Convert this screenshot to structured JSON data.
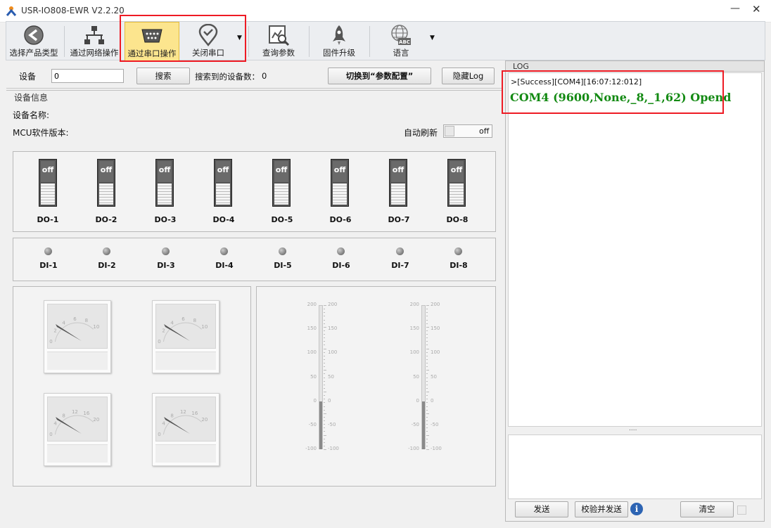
{
  "window": {
    "title": "USR-IO808-EWR V2.2.20"
  },
  "toolbar": {
    "items": [
      {
        "label": "选择产品类型",
        "icon": "back-arrow-icon"
      },
      {
        "label": "通过网络操作",
        "icon": "network-icon"
      },
      {
        "label": "通过串口操作",
        "icon": "serial-port-icon",
        "active": true
      },
      {
        "label": "关闭串口",
        "icon": "location-check-icon"
      },
      {
        "label": "查询参数",
        "icon": "query-chart-icon"
      },
      {
        "label": "固件升级",
        "icon": "rocket-icon"
      },
      {
        "label": "语言",
        "icon": "globe-abc-icon"
      }
    ]
  },
  "device_bar": {
    "device_label": "设备",
    "device_value": "0",
    "search_label": "搜索",
    "found_label": "搜索到的设备数：",
    "found_count": "0",
    "switch_label": "切换到“参数配置”",
    "hide_log_label": "隐藏Log"
  },
  "info": {
    "group_title": "设备信息",
    "name_label": "设备名称:",
    "mcu_label": "MCU软件版本:",
    "auto_refresh_label": "自动刷新",
    "auto_refresh_state": "off"
  },
  "do_outputs": [
    {
      "label": "DO-1",
      "state": "off"
    },
    {
      "label": "DO-2",
      "state": "off"
    },
    {
      "label": "DO-3",
      "state": "off"
    },
    {
      "label": "DO-4",
      "state": "off"
    },
    {
      "label": "DO-5",
      "state": "off"
    },
    {
      "label": "DO-6",
      "state": "off"
    },
    {
      "label": "DO-7",
      "state": "off"
    },
    {
      "label": "DO-8",
      "state": "off"
    }
  ],
  "di_inputs": [
    {
      "label": "DI-1"
    },
    {
      "label": "DI-2"
    },
    {
      "label": "DI-3"
    },
    {
      "label": "DI-4"
    },
    {
      "label": "DI-5"
    },
    {
      "label": "DI-6"
    },
    {
      "label": "DI-7"
    },
    {
      "label": "DI-8"
    }
  ],
  "gauges": [
    {
      "ticks": [
        "0",
        "2",
        "4",
        "6",
        "8",
        "10"
      ],
      "value": 0
    },
    {
      "ticks": [
        "0",
        "2",
        "4",
        "6",
        "8",
        "10"
      ],
      "value": 0
    },
    {
      "ticks": [
        "0",
        "4",
        "8",
        "12",
        "16",
        "20"
      ],
      "value": 0
    },
    {
      "ticks": [
        "0",
        "4",
        "8",
        "12",
        "16",
        "20"
      ],
      "value": 0
    }
  ],
  "sliders": {
    "ticks": [
      "200",
      "150",
      "100",
      "50",
      "0",
      "-50",
      "-100"
    ],
    "values": [
      0,
      0
    ]
  },
  "log": {
    "title": "LOG",
    "line1": ">[Success][COM4][16:07:12:012]",
    "line2": "COM4 (9600,None,_8,_1,62) Opend",
    "line2_color": "#138a13",
    "splitter": "....",
    "send_label": "发送",
    "check_send_label": "校验并发送",
    "clear_label": "清空"
  }
}
